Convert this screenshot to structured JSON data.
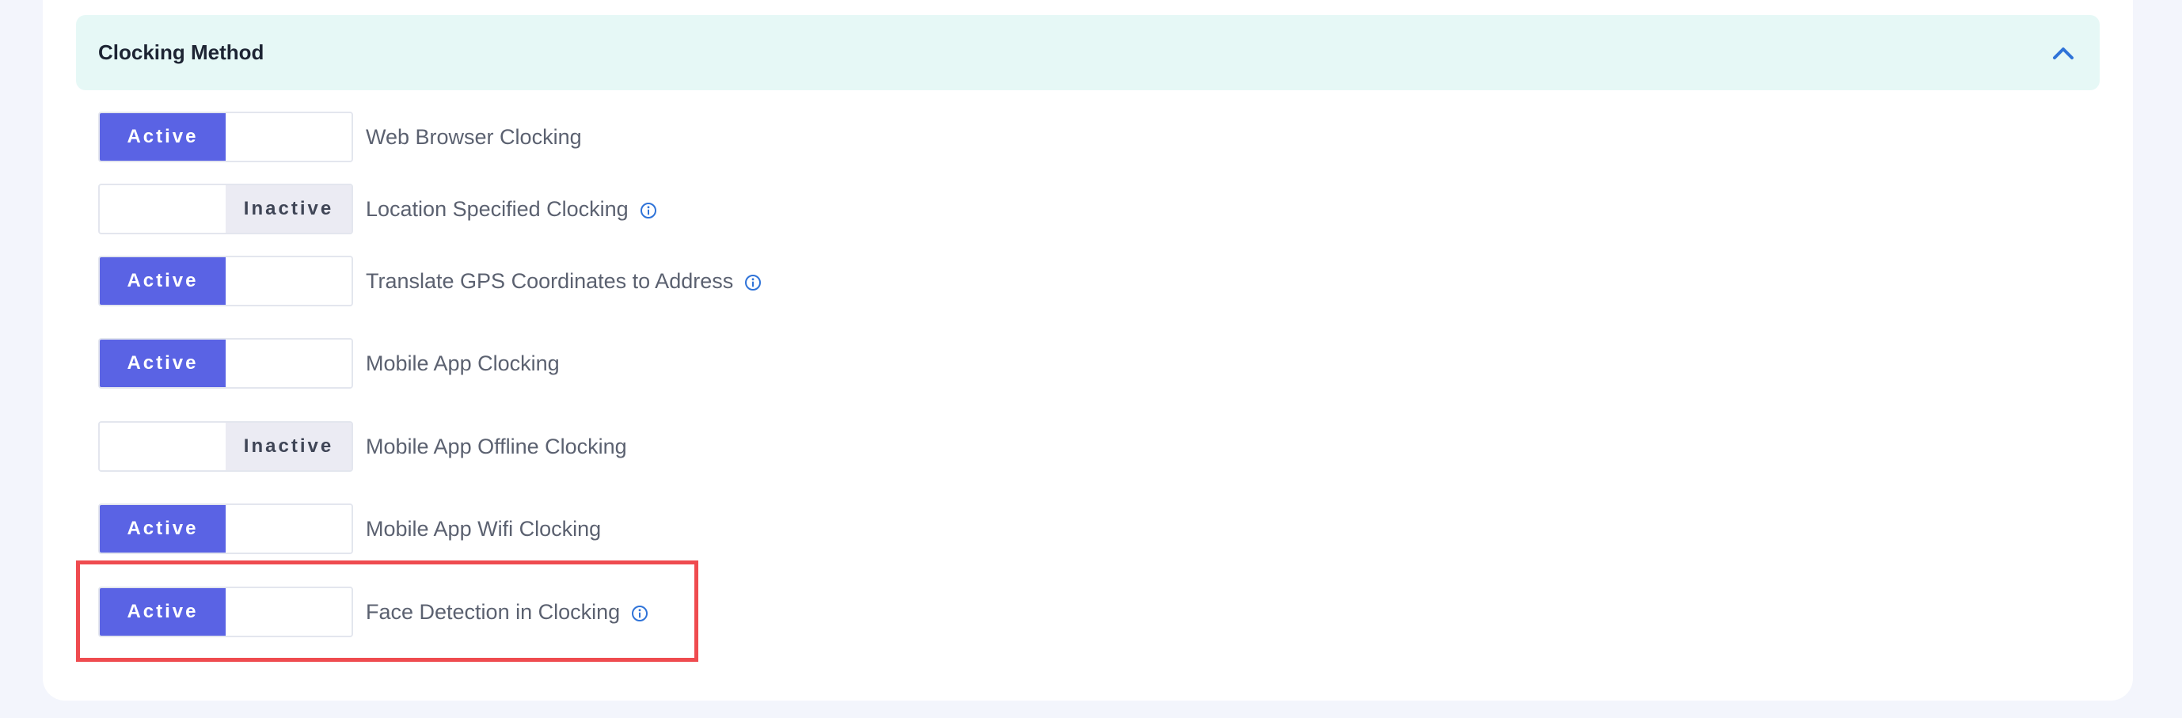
{
  "section": {
    "title": "Clocking Method"
  },
  "states": {
    "active": "Active",
    "inactive": "Inactive"
  },
  "rows": [
    {
      "label": "Web Browser Clocking",
      "state": "active",
      "info": false
    },
    {
      "label": "Location Specified Clocking",
      "state": "inactive",
      "info": true
    },
    {
      "label": "Translate GPS Coordinates to Address",
      "state": "active",
      "info": true
    },
    {
      "label": "Mobile App Clocking",
      "state": "active",
      "info": false
    },
    {
      "label": "Mobile App Offline Clocking",
      "state": "inactive",
      "info": false
    },
    {
      "label": "Mobile App Wifi Clocking",
      "state": "active",
      "info": false
    },
    {
      "label": "Face Detection in Clocking",
      "state": "active",
      "info": true,
      "highlighted": true
    }
  ],
  "colors": {
    "active": "#5a63e4",
    "inactive_bg": "#ebebf3",
    "header_bg": "#e6f8f6",
    "highlight": "#ef4b4f",
    "info_icon": "#2f73d8",
    "chevron": "#2f73d8"
  },
  "icons": {
    "chevron": "chevron-up-icon",
    "info": "info-icon"
  }
}
